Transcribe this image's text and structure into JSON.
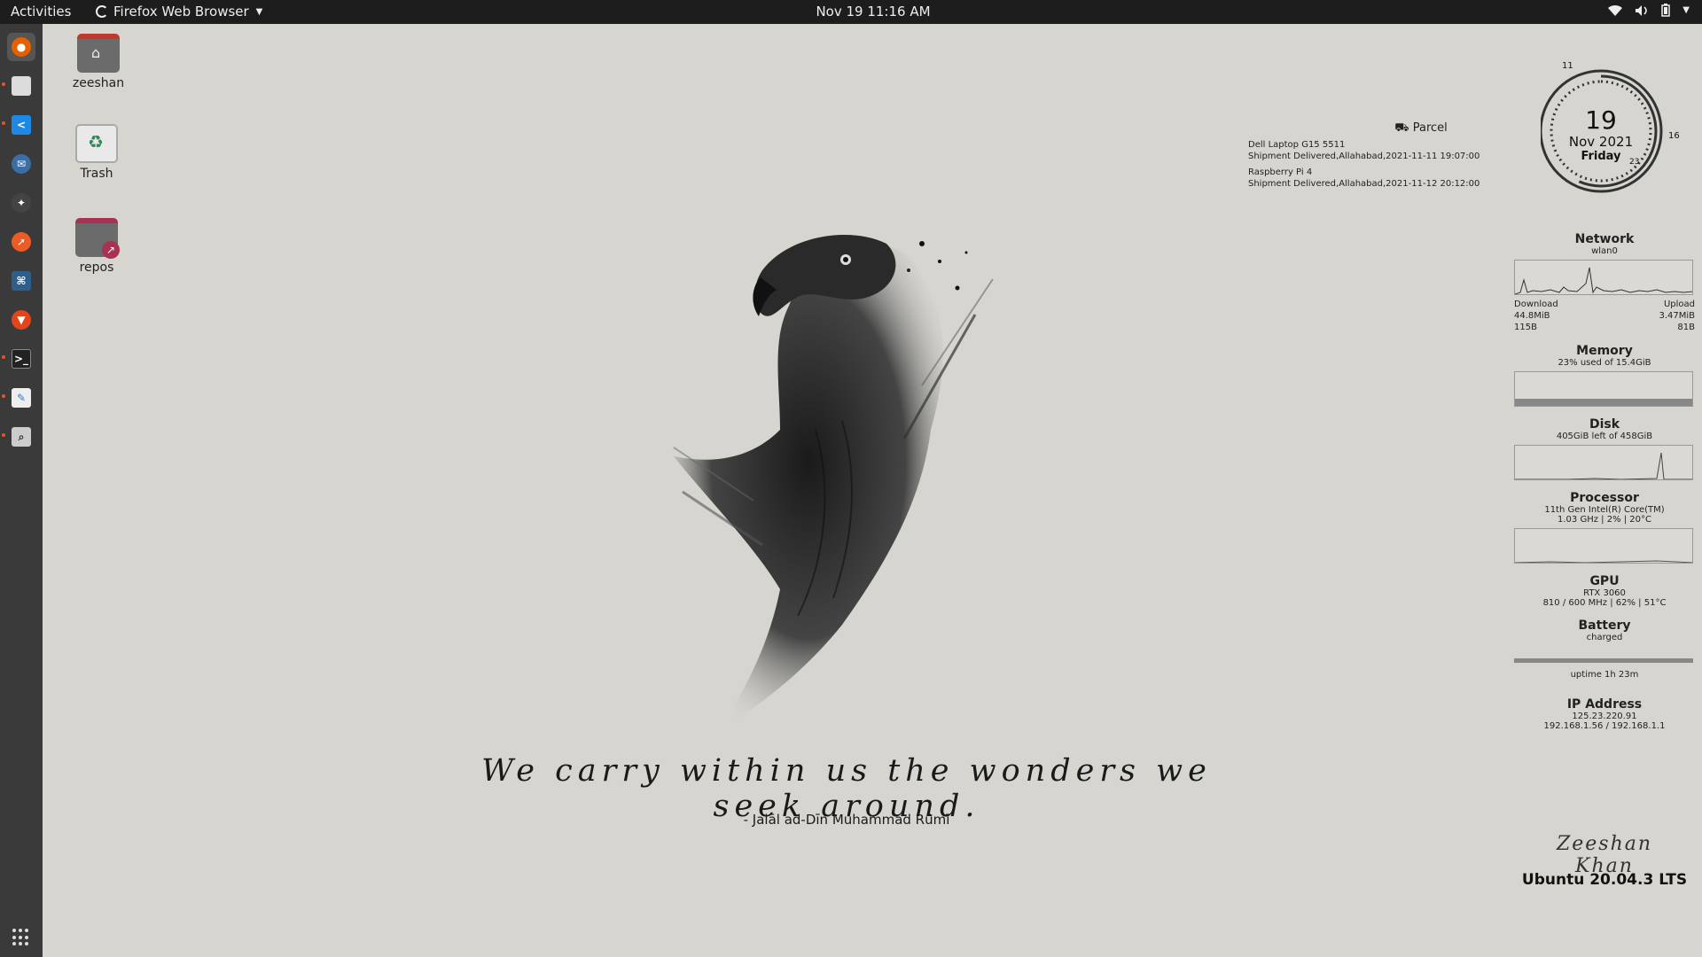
{
  "topbar": {
    "activities": "Activities",
    "app_name": "Firefox Web Browser",
    "clock": "Nov 19  11:16 AM",
    "tray_icons": [
      "wifi-icon",
      "volume-icon",
      "battery-icon",
      "chevron-down-icon"
    ]
  },
  "dock": {
    "items": [
      {
        "name": "firefox",
        "color": "#e66000",
        "active": true
      },
      {
        "name": "files",
        "color": "#dcdcdc",
        "running": true
      },
      {
        "name": "vscode",
        "color": "#1e88e5",
        "running": true
      },
      {
        "name": "thunderbird",
        "color": "#3a6ea5"
      },
      {
        "name": "postman-like",
        "color": "#444444"
      },
      {
        "name": "postman",
        "color": "#ef5b25"
      },
      {
        "name": "mysql-workbench",
        "color": "#2e5e8a"
      },
      {
        "name": "brave",
        "color": "#e0451c"
      },
      {
        "name": "terminal",
        "color": "#222222",
        "running": true
      },
      {
        "name": "text-editor",
        "color": "#3478c6",
        "running": true
      },
      {
        "name": "search",
        "color": "#cccccc",
        "running": true
      }
    ]
  },
  "desktop": {
    "icons": [
      {
        "label": "zeeshan",
        "type": "home-folder"
      },
      {
        "label": "Trash",
        "type": "trash"
      },
      {
        "label": "repos",
        "type": "folder-link"
      }
    ]
  },
  "quote": {
    "text": "We carry within us the wonders we seek around.",
    "author": "- Jalāl ad-Dīn Muhammad Rūmī"
  },
  "parcel": {
    "title": "Parcel",
    "entries": [
      {
        "item": "Dell Laptop G15 5511",
        "status": "Shipment Delivered,Allahabad,2021-11-11 19:07:00"
      },
      {
        "item": "Raspberry Pi 4",
        "status": "Shipment Delivered,Allahabad,2021-11-12 20:12:00"
      }
    ]
  },
  "clock_widget": {
    "day": "19",
    "month_year": "Nov 2021",
    "weekday": "Friday",
    "hour_label": "11",
    "minute_label": "16",
    "second_label": "23"
  },
  "sysmon": {
    "network": {
      "title": "Network",
      "iface": "wlan0",
      "download_label": "Download",
      "upload_label": "Upload",
      "download_total": "44.8MiB",
      "upload_total": "3.47MiB",
      "download_rate": "115B",
      "upload_rate": "81B"
    },
    "memory": {
      "title": "Memory",
      "detail": "23% used of 15.4GiB",
      "used_fraction": 0.23
    },
    "disk": {
      "title": "Disk",
      "detail": "405GiB left of 458GiB"
    },
    "processor": {
      "title": "Processor",
      "model": "11th Gen Intel(R) Core(TM)",
      "detail": "1.03 GHz | 2% | 20°C"
    },
    "gpu": {
      "title": "GPU",
      "model": "RTX 3060",
      "detail": "810 / 600 MHz | 62% | 51°C"
    },
    "battery": {
      "title": "Battery",
      "status": "charged",
      "uptime": "uptime 1h 23m",
      "level": 1.0
    },
    "ip": {
      "title": "IP Address",
      "public": "125.23.220.91",
      "local": "192.168.1.56 / 192.168.1.1"
    }
  },
  "signature": "Zeeshan Khan",
  "os_label": "Ubuntu 20.04.3 LTS"
}
